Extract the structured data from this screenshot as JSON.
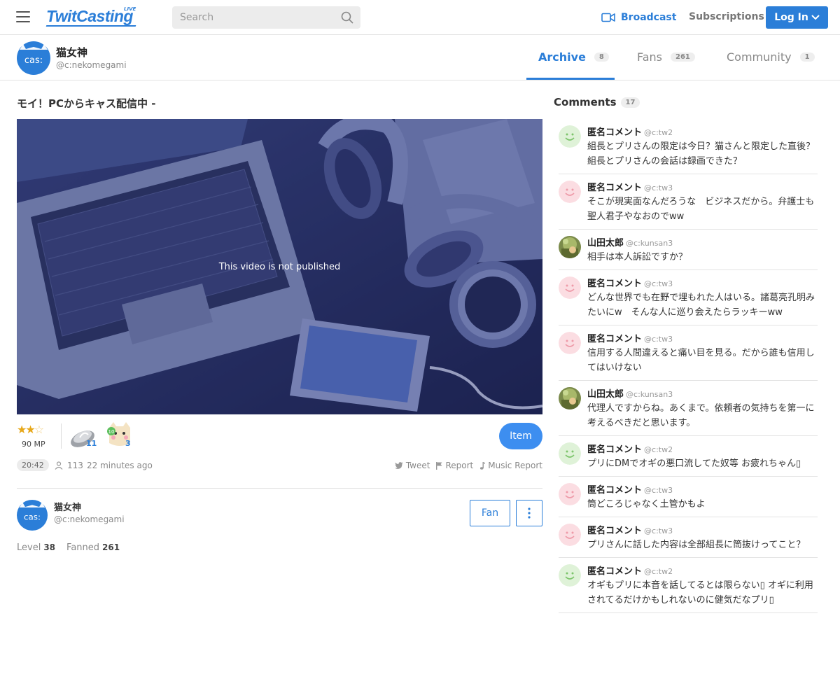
{
  "header": {
    "logo": "TwitCasting",
    "logo_badge": "LIVE",
    "search_placeholder": "Search",
    "broadcast_label": "Broadcast",
    "subscriptions_label": "Subscriptions",
    "login_label": "Log In",
    "accent_color": "#2b7ed8"
  },
  "profile": {
    "name": "猫女神",
    "id": "@c:nekomegami",
    "avatar_text": "cas:",
    "tabs": [
      {
        "label": "Archive",
        "count": "8",
        "active": true
      },
      {
        "label": "Fans",
        "count": "261",
        "active": false
      },
      {
        "label": "Community",
        "count": "1",
        "active": false
      }
    ]
  },
  "movie": {
    "title": "モイ！PCからキャス配信中 -",
    "player_message": "This video is not published",
    "rating_stars": 2.5,
    "mp": "90 MP",
    "gifts": [
      {
        "icon": "tea-cup-icon",
        "count": "11"
      },
      {
        "icon": "cat-doll-icon",
        "count": "3",
        "level": "10"
      }
    ],
    "item_label": "Item",
    "duration": "20:42",
    "viewers": "113",
    "time_ago": "22 minutes ago",
    "actions": {
      "tweet": "Tweet",
      "report": "Report",
      "music_report": "Music Report"
    }
  },
  "owner": {
    "name": "猫女神",
    "id": "@c:nekomegami",
    "fan_label": "Fan",
    "level_label": "Level",
    "level": "38",
    "fanned_label": "Fanned",
    "fanned": "261"
  },
  "comments": {
    "title": "Comments",
    "count": "17",
    "items": [
      {
        "name": "匿名コメント",
        "id": "@c:tw2",
        "avatar": "smiley-green",
        "text": "組長とプリさんの限定は今日？猫さんと限定した直後？ 組長とプリさんの会話は録画できた？"
      },
      {
        "name": "匿名コメント",
        "id": "@c:tw3",
        "avatar": "smiley-pink",
        "text": "そこが現実面なんだろうな　ビジネスだから。弁護士も聖人君子やなおのでww"
      },
      {
        "name": "山田太郎",
        "id": "@c:kunsan3",
        "avatar": "photo",
        "text": "相手は本人訴訟ですか？"
      },
      {
        "name": "匿名コメント",
        "id": "@c:tw3",
        "avatar": "smiley-pink",
        "text": "どんな世界でも在野で埋もれた人はいる。諸葛亮孔明みたいにw　そんな人に巡り会えたらラッキーww"
      },
      {
        "name": "匿名コメント",
        "id": "@c:tw3",
        "avatar": "smiley-pink",
        "text": "信用する人間違えると痛い目を見る。だから誰も信用してはいけない"
      },
      {
        "name": "山田太郎",
        "id": "@c:kunsan3",
        "avatar": "photo",
        "text": "代理人ですからね。あくまで。依頼者の気持ちを第一に考えるべきだと思います。"
      },
      {
        "name": "匿名コメント",
        "id": "@c:tw2",
        "avatar": "smiley-green",
        "text": "プリにDMでオギの悪口流してた奴等 お疲れちゃん▯"
      },
      {
        "name": "匿名コメント",
        "id": "@c:tw3",
        "avatar": "smiley-pink",
        "text": "筒どころじゃなく土管かもよ"
      },
      {
        "name": "匿名コメント",
        "id": "@c:tw3",
        "avatar": "smiley-pink",
        "text": "プリさんに話した内容は全部組長に筒抜けってこと？"
      },
      {
        "name": "匿名コメント",
        "id": "@c:tw2",
        "avatar": "smiley-green",
        "text": "オギもプリに本音を話してるとは限らない▯ オギに利用されてるだけかもしれないのに健気だなプリ▯"
      }
    ]
  }
}
